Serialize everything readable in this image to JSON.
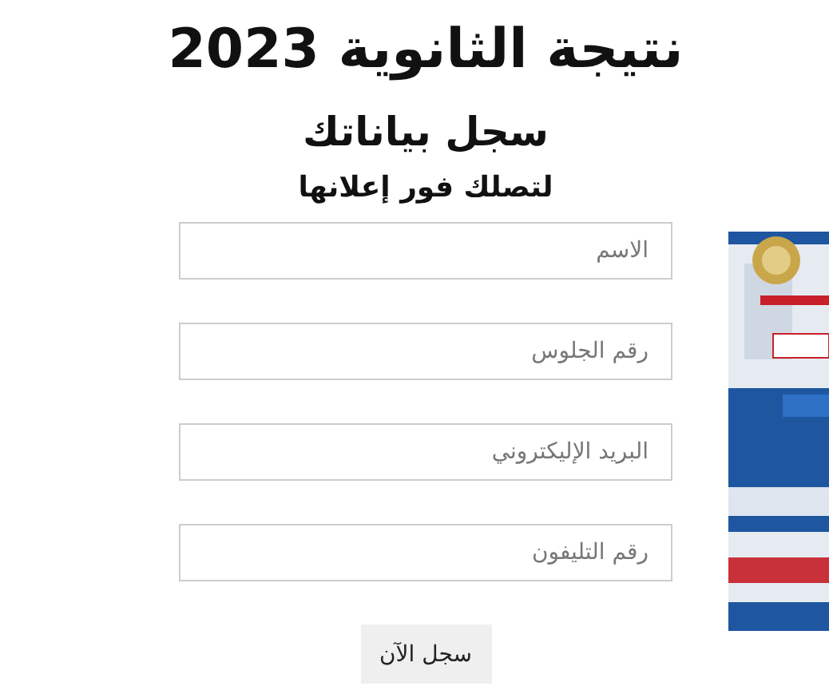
{
  "title": "نتيجة الثانوية 2023",
  "subtitle": "سجل بياناتك",
  "tagline": "لتصلك فور إعلانها",
  "fields": [
    {
      "placeholder": "الاسم"
    },
    {
      "placeholder": "رقم الجلوس"
    },
    {
      "placeholder": "البريد الإليكتروني"
    },
    {
      "placeholder": "رقم التليفون"
    }
  ],
  "submit_button": "سجل الآن"
}
